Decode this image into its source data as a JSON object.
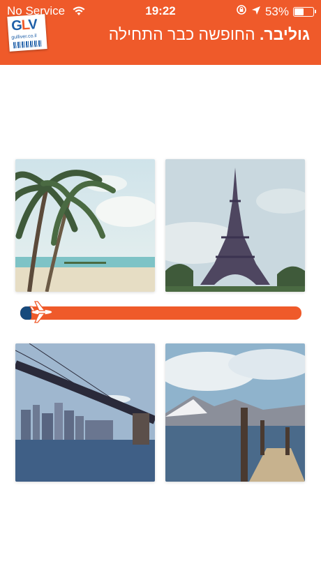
{
  "status_bar": {
    "carrier": "No Service",
    "time": "19:22",
    "battery_percent": "53%",
    "battery_level": 0.53,
    "icons": [
      "wifi-icon",
      "orientation-lock-icon",
      "location-arrow-icon",
      "battery-icon"
    ]
  },
  "header": {
    "logo_text": "GLV",
    "logo_url": "gulliver.co.il",
    "tagline_brand": "גוליבר.",
    "tagline_text": " החופשה כבר התחילה",
    "color": "#ef5a2a"
  },
  "photos": [
    {
      "subject": "tropical-beach",
      "position": "top-left"
    },
    {
      "subject": "eiffel-tower",
      "position": "top-right"
    },
    {
      "subject": "brooklyn-bridge",
      "position": "bottom-left"
    },
    {
      "subject": "lake-pier",
      "position": "bottom-right"
    }
  ],
  "loading": {
    "progress": 0.04,
    "track_color": "#ef5a2a",
    "knob_color": "#174a7c",
    "icon": "airplane-icon"
  }
}
